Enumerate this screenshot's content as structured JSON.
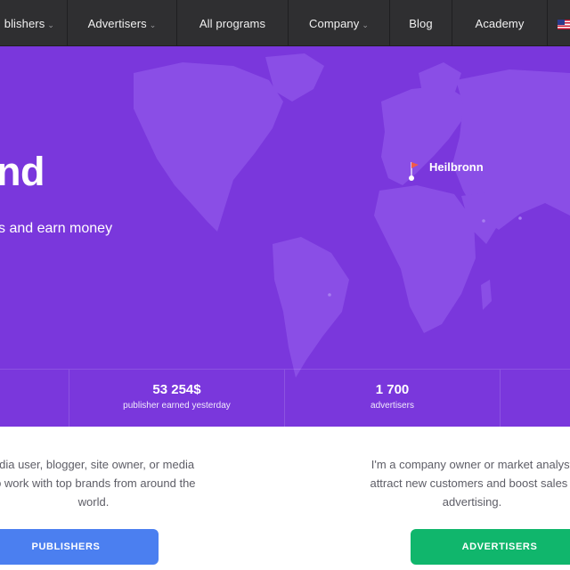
{
  "nav": {
    "items": [
      {
        "label": "blishers",
        "has_dropdown": true
      },
      {
        "label": "Advertisers",
        "has_dropdown": true
      },
      {
        "label": "All programs",
        "has_dropdown": false
      },
      {
        "label": "Company",
        "has_dropdown": true
      },
      {
        "label": "Blog",
        "has_dropdown": false
      },
      {
        "label": "Academy",
        "has_dropdown": false
      }
    ],
    "dropdown_glyph": "⌄",
    "language_icon": "us-flag-icon"
  },
  "hero": {
    "title": "nd",
    "subtitle": "s and earn money",
    "map_pin_label": "Heilbronn",
    "background_color": "#7a37dc"
  },
  "stats": [
    {
      "value": "53 254$",
      "label": "publisher earned yesterday"
    },
    {
      "value": "1 700",
      "label": "advertisers"
    }
  ],
  "audience": {
    "publishers": {
      "description_lines": [
        "edia user, blogger, site owner, or media",
        "to work with top brands from around the",
        "world."
      ],
      "button_label": "PUBLISHERS",
      "button_color": "#4b7ff0"
    },
    "advertisers": {
      "description_lines": [
        "I'm a company owner or market analyst",
        "attract new customers and boost sales t",
        "advertising."
      ],
      "button_label": "ADVERTISERS",
      "button_color": "#10b66c"
    }
  }
}
